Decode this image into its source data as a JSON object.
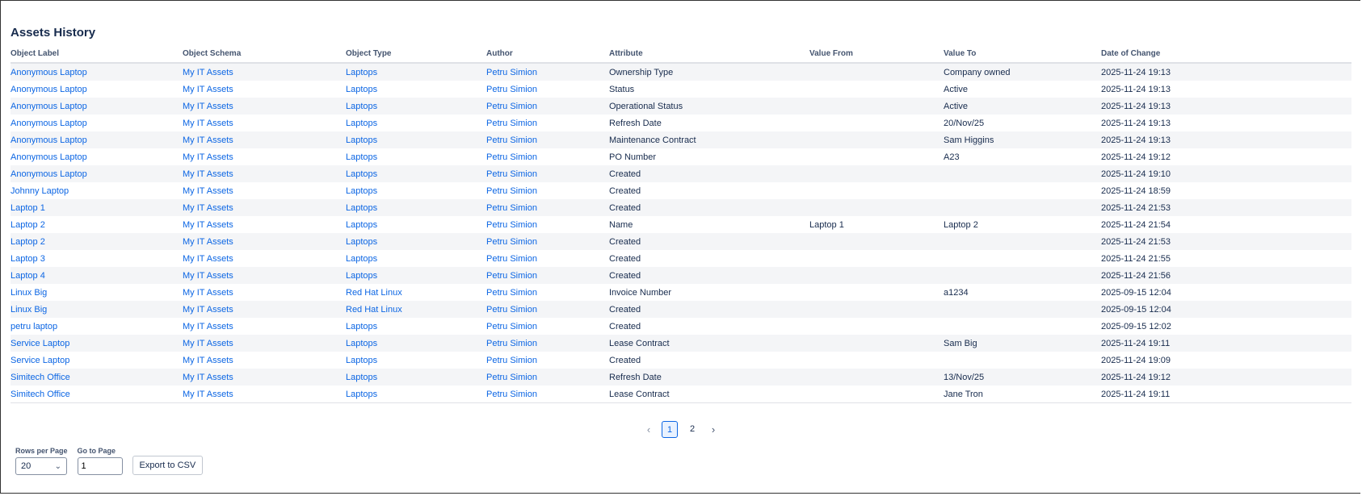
{
  "title": "Assets History",
  "columns": [
    "Object Label",
    "Object Schema",
    "Object Type",
    "Author",
    "Attribute",
    "Value From",
    "Value To",
    "Date of Change"
  ],
  "rows": [
    [
      "Anonymous Laptop",
      "My IT Assets",
      "Laptops",
      "Petru Simion",
      "Ownership Type",
      "",
      "Company owned",
      "2025-11-24 19:13"
    ],
    [
      "Anonymous Laptop",
      "My IT Assets",
      "Laptops",
      "Petru Simion",
      "Status",
      "",
      "Active",
      "2025-11-24 19:13"
    ],
    [
      "Anonymous Laptop",
      "My IT Assets",
      "Laptops",
      "Petru Simion",
      "Operational Status",
      "",
      "Active",
      "2025-11-24 19:13"
    ],
    [
      "Anonymous Laptop",
      "My IT Assets",
      "Laptops",
      "Petru Simion",
      "Refresh Date",
      "",
      "20/Nov/25",
      "2025-11-24 19:13"
    ],
    [
      "Anonymous Laptop",
      "My IT Assets",
      "Laptops",
      "Petru Simion",
      "Maintenance Contract",
      "",
      "Sam Higgins",
      "2025-11-24 19:13"
    ],
    [
      "Anonymous Laptop",
      "My IT Assets",
      "Laptops",
      "Petru Simion",
      "PO Number",
      "",
      "A23",
      "2025-11-24 19:12"
    ],
    [
      "Anonymous Laptop",
      "My IT Assets",
      "Laptops",
      "Petru Simion",
      "Created",
      "",
      "",
      "2025-11-24 19:10"
    ],
    [
      "Johnny Laptop",
      "My IT Assets",
      "Laptops",
      "Petru Simion",
      "Created",
      "",
      "",
      "2025-11-24 18:59"
    ],
    [
      "Laptop 1",
      "My IT Assets",
      "Laptops",
      "Petru Simion",
      "Created",
      "",
      "",
      "2025-11-24 21:53"
    ],
    [
      "Laptop 2",
      "My IT Assets",
      "Laptops",
      "Petru Simion",
      "Name",
      "Laptop 1",
      "Laptop 2",
      "2025-11-24 21:54"
    ],
    [
      "Laptop 2",
      "My IT Assets",
      "Laptops",
      "Petru Simion",
      "Created",
      "",
      "",
      "2025-11-24 21:53"
    ],
    [
      "Laptop 3",
      "My IT Assets",
      "Laptops",
      "Petru Simion",
      "Created",
      "",
      "",
      "2025-11-24 21:55"
    ],
    [
      "Laptop 4",
      "My IT Assets",
      "Laptops",
      "Petru Simion",
      "Created",
      "",
      "",
      "2025-11-24 21:56"
    ],
    [
      "Linux Big",
      "My IT Assets",
      "Red Hat Linux",
      "Petru Simion",
      "Invoice Number",
      "",
      "a1234",
      "2025-09-15 12:04"
    ],
    [
      "Linux Big",
      "My IT Assets",
      "Red Hat Linux",
      "Petru Simion",
      "Created",
      "",
      "",
      "2025-09-15 12:04"
    ],
    [
      "petru laptop",
      "My IT Assets",
      "Laptops",
      "Petru Simion",
      "Created",
      "",
      "",
      "2025-09-15 12:02"
    ],
    [
      "Service Laptop",
      "My IT Assets",
      "Laptops",
      "Petru Simion",
      "Lease Contract",
      "",
      "Sam Big",
      "2025-11-24 19:11"
    ],
    [
      "Service Laptop",
      "My IT Assets",
      "Laptops",
      "Petru Simion",
      "Created",
      "",
      "",
      "2025-11-24 19:09"
    ],
    [
      "Simitech Office",
      "My IT Assets",
      "Laptops",
      "Petru Simion",
      "Refresh Date",
      "",
      "13/Nov/25",
      "2025-11-24 19:12"
    ],
    [
      "Simitech Office",
      "My IT Assets",
      "Laptops",
      "Petru Simion",
      "Lease Contract",
      "",
      "Jane Tron",
      "2025-11-24 19:11"
    ]
  ],
  "pagination": {
    "prev_icon": "chevron-left-icon",
    "next_icon": "chevron-right-icon",
    "pages": [
      "1",
      "2"
    ],
    "current": "1"
  },
  "controls": {
    "rows_per_page_label": "Rows per Page",
    "rows_per_page_value": "20",
    "go_to_page_label": "Go to Page",
    "go_to_page_value": "1",
    "export_label": "Export to CSV"
  },
  "colors": {
    "link": "#0c66e4",
    "text": "#172b4d",
    "stripe": "#f4f5f7",
    "active_page": "#0c66e4"
  }
}
